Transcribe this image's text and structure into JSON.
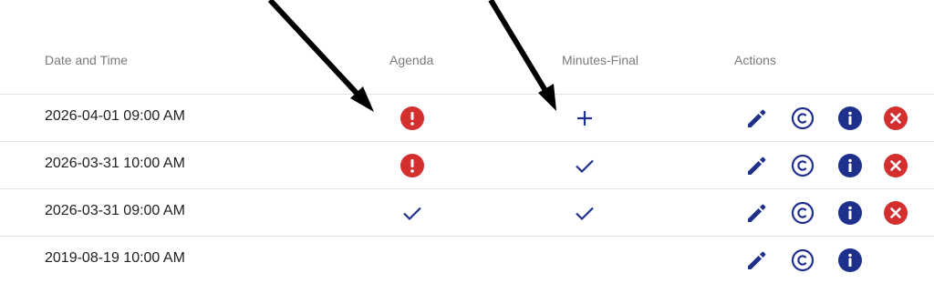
{
  "columns": {
    "date": "Date and Time",
    "agenda": "Agenda",
    "minutes": "Minutes-Final",
    "actions": "Actions"
  },
  "rows": [
    {
      "datetime": "2026-04-01 09:00 AM",
      "agenda_status": "alert-icon",
      "minutes_status": "plus-icon",
      "has_delete": true
    },
    {
      "datetime": "2026-03-31 10:00 AM",
      "agenda_status": "alert-icon",
      "minutes_status": "check-icon",
      "has_delete": true
    },
    {
      "datetime": "2026-03-31 09:00 AM",
      "agenda_status": "check-icon",
      "minutes_status": "check-icon",
      "has_delete": true
    },
    {
      "datetime": "2019-08-19 10:00 AM",
      "agenda_status": "none",
      "minutes_status": "none",
      "has_delete": false
    }
  ],
  "actions": [
    "edit-icon",
    "copyright-icon",
    "info-icon",
    "delete-icon"
  ],
  "colors": {
    "primary": "#1f2f8c",
    "alert": "#d32f2f",
    "header_text": "#7a7a7a",
    "body_text": "#212121",
    "divider": "#e2e2e2",
    "annotation_arrow": "#000000"
  }
}
